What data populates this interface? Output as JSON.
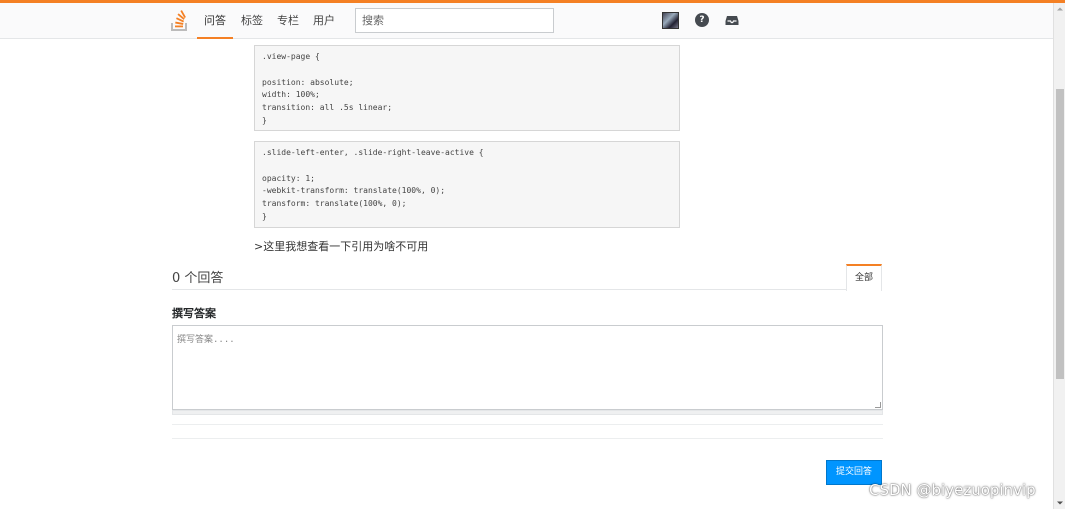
{
  "theme": {
    "accent": "#f48024",
    "primary_button": "#0095ff"
  },
  "nav": {
    "items": [
      "问答",
      "标签",
      "专栏",
      "用户"
    ],
    "active_index": 0,
    "search_placeholder": "搜索",
    "icons": [
      "stack-logo-icon",
      "avatar",
      "help-icon",
      "inbox-icon"
    ]
  },
  "content": {
    "code_block_1": ".view-page {\n\nposition: absolute;\nwidth: 100%;\ntransition: all .5s linear;\n}",
    "code_block_2": ".slide-left-enter, .slide-right-leave-active {\n\nopacity: 1;\n-webkit-transform: translate(100%, 0);\ntransform: translate(100%, 0);\n}",
    "quote_text": ">这里我想查看一下引用为啥不可用"
  },
  "answers": {
    "count_label": "0 个回答",
    "tab_all": "全部"
  },
  "compose": {
    "heading": "撰写答案",
    "placeholder": "撰写答案....",
    "submit_label": "提交回答"
  },
  "watermark": "CSDN @biyezuopinvip"
}
